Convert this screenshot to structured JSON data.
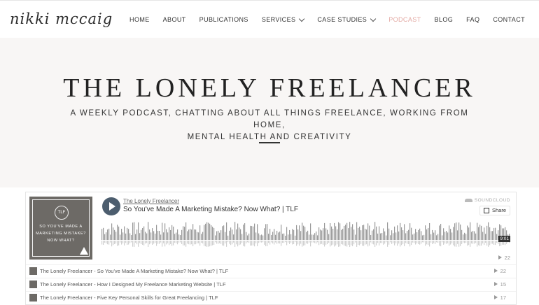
{
  "header": {
    "logo": "nikki mccaig",
    "nav": [
      {
        "label": "HOME",
        "dropdown": false,
        "active": false
      },
      {
        "label": "ABOUT",
        "dropdown": false,
        "active": false
      },
      {
        "label": "PUBLICATIONS",
        "dropdown": false,
        "active": false
      },
      {
        "label": "SERVICES",
        "dropdown": true,
        "active": false
      },
      {
        "label": "CASE STUDIES",
        "dropdown": true,
        "active": false
      },
      {
        "label": "PODCAST",
        "dropdown": false,
        "active": true
      },
      {
        "label": "BLOG",
        "dropdown": false,
        "active": false
      },
      {
        "label": "FAQ",
        "dropdown": false,
        "active": false
      },
      {
        "label": "CONTACT",
        "dropdown": false,
        "active": false
      }
    ],
    "active_color": "#e3a8a2"
  },
  "hero": {
    "title": "THE LONELY FREELANCER",
    "subtitle_line1": "A WEEKLY PODCAST, CHATTING ABOUT ALL THINGS FREELANCE, WORKING FROM HOME,",
    "subtitle_line2": "MENTAL HEALTH AND CREATIVITY"
  },
  "player": {
    "artist": "The Lonely Freelancer",
    "track_title": "So You've Made A Marketing Mistake? Now What? | TLF",
    "brand": "SOUNDCLOUD",
    "share_label": "Share",
    "duration": "9:01",
    "plays": "22",
    "artwork": {
      "badge": "TLF",
      "line1": "SO YOU'VE MADE A",
      "line2": "MARKETING MISTAKE?",
      "line3": "NOW WHAT?"
    },
    "tracks": [
      {
        "title": "The Lonely Freelancer - So You've Made A Marketing Mistake? Now What? | TLF",
        "plays": "22"
      },
      {
        "title": "The Lonely Freelancer - How I Designed My Freelance Marketing Website | TLF",
        "plays": "15"
      },
      {
        "title": "The Lonely Freelancer - Five Key Personal Skills for Great Freelancing | TLF",
        "plays": "17"
      }
    ]
  }
}
